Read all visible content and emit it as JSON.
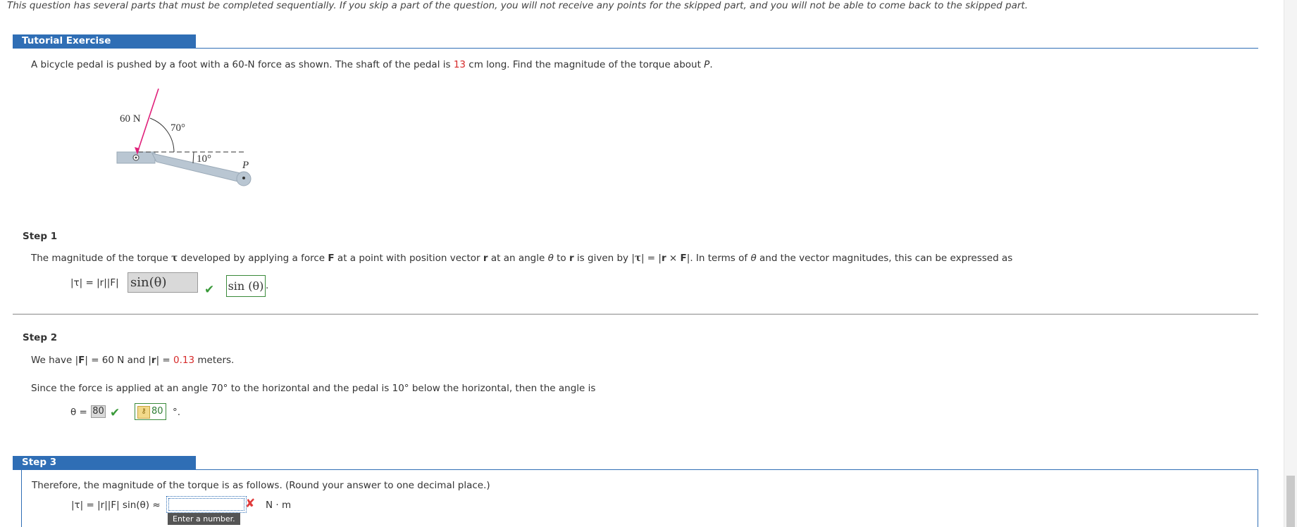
{
  "notice": "This question has several parts that must be completed sequentially. If you skip a part of the question, you will not receive any points for the skipped part, and you will not be able to come back to the skipped part.",
  "tutorial": {
    "header": "Tutorial Exercise",
    "problem_pre": "A bicycle pedal is pushed by a foot with a 60-N force as shown. The shaft of the pedal is ",
    "problem_len": "13",
    "problem_mid": " cm long. Find the magnitude of the torque about ",
    "problem_point": "P",
    "problem_end": "."
  },
  "figure": {
    "force_label": "60 N",
    "angle1": "70°",
    "angle2": "10°",
    "point": "P"
  },
  "step1": {
    "label": "Step 1",
    "text_a": "The magnitude of the torque ",
    "tau": "τ",
    "text_b": " developed by applying a force ",
    "F": "F",
    "text_c": " at a point with position vector ",
    "r": "r",
    "text_d": " at an angle ",
    "theta": "θ",
    "text_e": " to ",
    "text_f": " is given by  |",
    "text_g": "| = |",
    "cross": " × ",
    "text_h": "|.  In terms of ",
    "text_i": " and the vector magnitudes, this can be expressed as",
    "eq_left": "|τ| = |r||F|",
    "entered": "sin(θ)",
    "correct": "sin (θ)",
    "trail": "."
  },
  "step2": {
    "label": "Step 2",
    "have_a": "We have  |",
    "have_F": "F",
    "have_b": "| = 60 N and  |",
    "have_r": "r",
    "have_c": "| = ",
    "have_val": "0.13",
    "have_d": " meters.",
    "since": "Since the force is applied at an angle 70° to the horizontal and the pedal is 10° below the horizontal, then the angle is",
    "theta_eq": "θ = ",
    "entered": "80",
    "correct": "80",
    "unit": "°."
  },
  "step3": {
    "header": "Step 3",
    "text": "Therefore, the magnitude of the torque is as follows. (Round your answer to one decimal place.)",
    "eq": "|τ| = |r||F| sin(θ) ≈",
    "input_value": "",
    "unit": "N · m",
    "tooltip": "Enter a number."
  },
  "colors": {
    "accent": "#2f6eb5",
    "red": "#d62a2a",
    "green": "#3a9a3a",
    "force_arrow": "#e0207a"
  }
}
